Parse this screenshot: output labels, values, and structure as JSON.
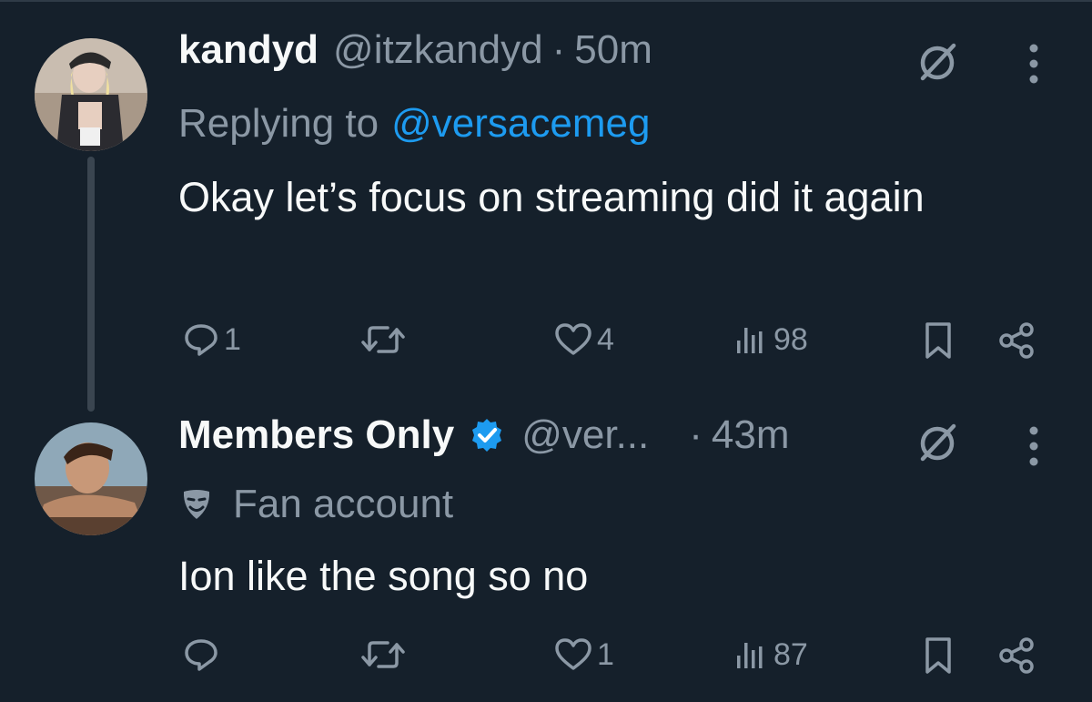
{
  "tweets": [
    {
      "name": "kandyd",
      "handle": "@itzkandyd",
      "separator": "·",
      "time": "50m",
      "replying_prefix": "Replying to",
      "replying_to": "@versacemeg",
      "text": "Okay let’s focus on streaming did it again",
      "replies": "1",
      "retweets": "",
      "likes": "4",
      "views": "98"
    },
    {
      "name": "Members Only",
      "handle": "@ver...",
      "separator": "·",
      "time": "43m",
      "account_label": "Fan account",
      "text": "Ion like the song so no",
      "replies": "",
      "retweets": "",
      "likes": "1",
      "views": "87"
    }
  ],
  "colors": {
    "background": "#15202b",
    "text": "#f7f9f9",
    "muted": "#8b98a5",
    "accent": "#1d9bf0"
  },
  "icons": [
    "reply-icon",
    "retweet-icon",
    "like-icon",
    "views-icon",
    "bookmark-icon",
    "share-icon",
    "grok-icon",
    "more-icon",
    "verified-icon",
    "fan-account-mask-icon"
  ]
}
